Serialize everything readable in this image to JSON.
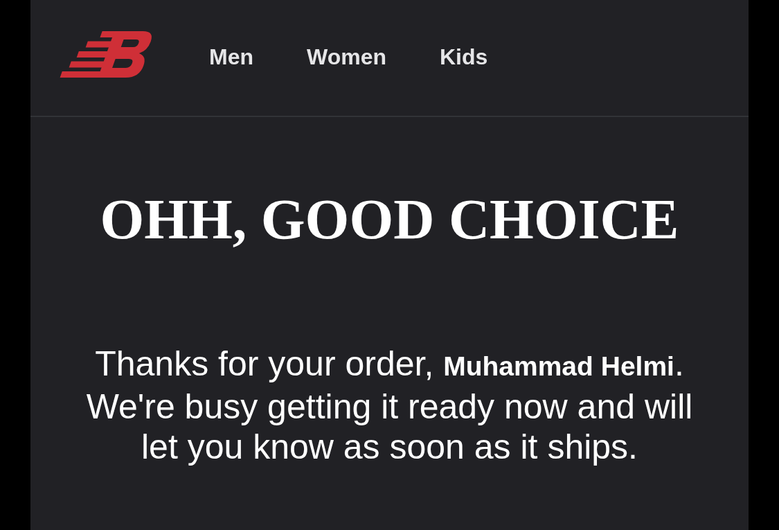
{
  "nav_links": [
    "Men",
    "Women",
    "Kids"
  ],
  "heading": "OHH, GOOD CHOICE",
  "message": "Thanks for your order, **Muhammad Helmi**. We're busy getting it ready now and will let you know as soon as it ships."
}
